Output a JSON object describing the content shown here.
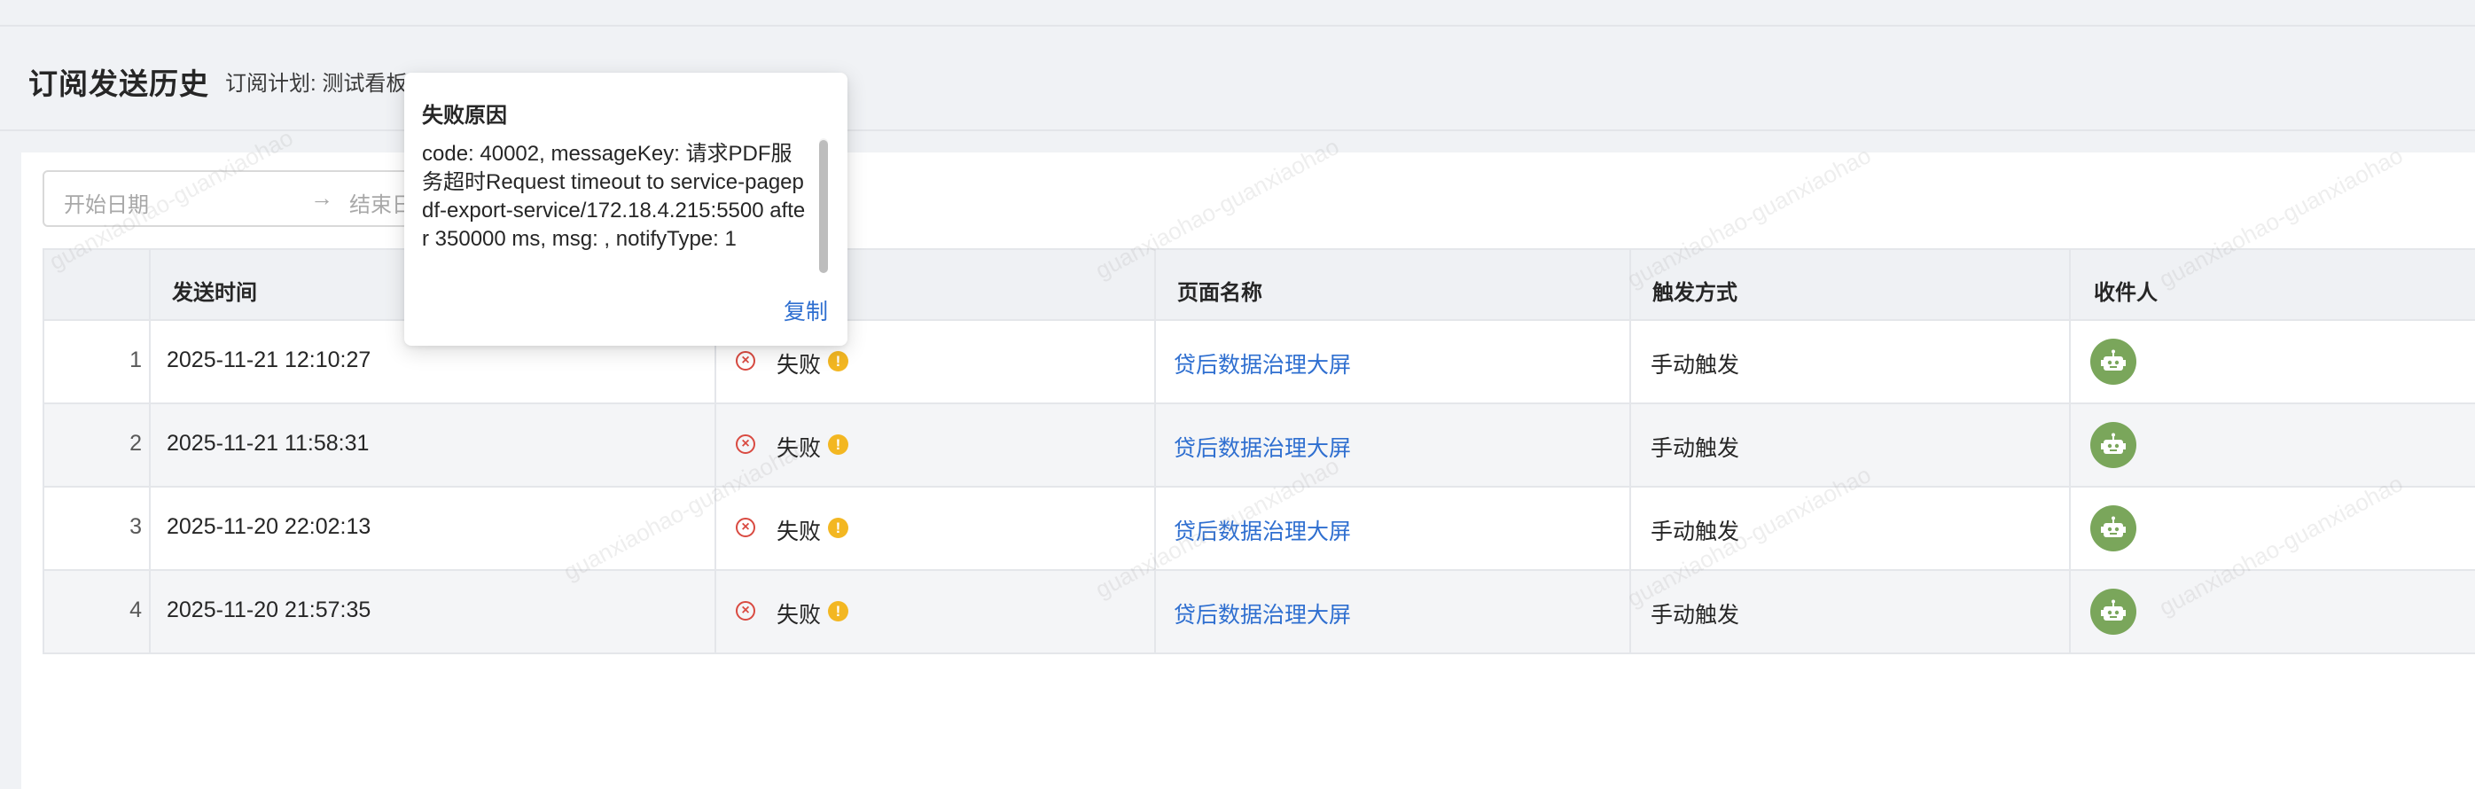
{
  "header": {
    "title": "订阅发送历史",
    "plan_label": "订阅计划: 测试看板"
  },
  "filters": {
    "start_placeholder": "开始日期",
    "arrow": "→",
    "end_placeholder": "结束日"
  },
  "table": {
    "columns": [
      "发送时间",
      "页面名称",
      "触发方式",
      "收件人"
    ],
    "rows": [
      {
        "index": "1",
        "time": "2025-11-21 12:10:27",
        "status": "失败",
        "page": "贷后数据治理大屏",
        "trigger": "手动触发"
      },
      {
        "index": "2",
        "time": "2025-11-21 11:58:31",
        "status": "失败",
        "page": "贷后数据治理大屏",
        "trigger": "手动触发"
      },
      {
        "index": "3",
        "time": "2025-11-20 22:02:13",
        "status": "失败",
        "page": "贷后数据治理大屏",
        "trigger": "手动触发"
      },
      {
        "index": "4",
        "time": "2025-11-20 21:57:35",
        "status": "失败",
        "page": "贷后数据治理大屏",
        "trigger": "手动触发"
      }
    ]
  },
  "popover": {
    "title": "失败原因",
    "message": "code: 40002, messageKey: 请求PDF服务超时Request timeout to service-pagepdf-export-service/172.18.4.215:5500 after 350000 ms, msg: , notifyType: 1",
    "copy_label": "复制"
  },
  "watermark": "guanxiaohao-guanxiaohao",
  "colors": {
    "link": "#2f6fd0",
    "fail": "#d94a41",
    "warn": "#f3b722",
    "robot": "#7aa65b"
  }
}
